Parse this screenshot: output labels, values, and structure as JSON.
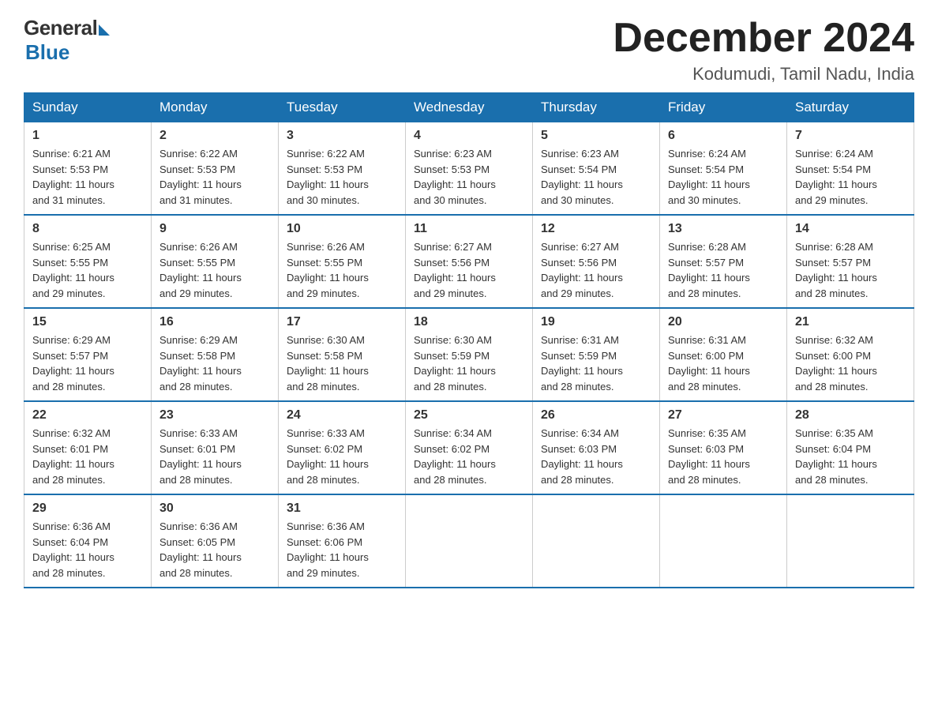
{
  "logo": {
    "general": "General",
    "blue": "Blue"
  },
  "title": "December 2024",
  "location": "Kodumudi, Tamil Nadu, India",
  "days_of_week": [
    "Sunday",
    "Monday",
    "Tuesday",
    "Wednesday",
    "Thursday",
    "Friday",
    "Saturday"
  ],
  "weeks": [
    [
      {
        "day": "1",
        "sunrise": "6:21 AM",
        "sunset": "5:53 PM",
        "daylight": "11 hours and 31 minutes."
      },
      {
        "day": "2",
        "sunrise": "6:22 AM",
        "sunset": "5:53 PM",
        "daylight": "11 hours and 31 minutes."
      },
      {
        "day": "3",
        "sunrise": "6:22 AM",
        "sunset": "5:53 PM",
        "daylight": "11 hours and 30 minutes."
      },
      {
        "day": "4",
        "sunrise": "6:23 AM",
        "sunset": "5:53 PM",
        "daylight": "11 hours and 30 minutes."
      },
      {
        "day": "5",
        "sunrise": "6:23 AM",
        "sunset": "5:54 PM",
        "daylight": "11 hours and 30 minutes."
      },
      {
        "day": "6",
        "sunrise": "6:24 AM",
        "sunset": "5:54 PM",
        "daylight": "11 hours and 30 minutes."
      },
      {
        "day": "7",
        "sunrise": "6:24 AM",
        "sunset": "5:54 PM",
        "daylight": "11 hours and 29 minutes."
      }
    ],
    [
      {
        "day": "8",
        "sunrise": "6:25 AM",
        "sunset": "5:55 PM",
        "daylight": "11 hours and 29 minutes."
      },
      {
        "day": "9",
        "sunrise": "6:26 AM",
        "sunset": "5:55 PM",
        "daylight": "11 hours and 29 minutes."
      },
      {
        "day": "10",
        "sunrise": "6:26 AM",
        "sunset": "5:55 PM",
        "daylight": "11 hours and 29 minutes."
      },
      {
        "day": "11",
        "sunrise": "6:27 AM",
        "sunset": "5:56 PM",
        "daylight": "11 hours and 29 minutes."
      },
      {
        "day": "12",
        "sunrise": "6:27 AM",
        "sunset": "5:56 PM",
        "daylight": "11 hours and 29 minutes."
      },
      {
        "day": "13",
        "sunrise": "6:28 AM",
        "sunset": "5:57 PM",
        "daylight": "11 hours and 28 minutes."
      },
      {
        "day": "14",
        "sunrise": "6:28 AM",
        "sunset": "5:57 PM",
        "daylight": "11 hours and 28 minutes."
      }
    ],
    [
      {
        "day": "15",
        "sunrise": "6:29 AM",
        "sunset": "5:57 PM",
        "daylight": "11 hours and 28 minutes."
      },
      {
        "day": "16",
        "sunrise": "6:29 AM",
        "sunset": "5:58 PM",
        "daylight": "11 hours and 28 minutes."
      },
      {
        "day": "17",
        "sunrise": "6:30 AM",
        "sunset": "5:58 PM",
        "daylight": "11 hours and 28 minutes."
      },
      {
        "day": "18",
        "sunrise": "6:30 AM",
        "sunset": "5:59 PM",
        "daylight": "11 hours and 28 minutes."
      },
      {
        "day": "19",
        "sunrise": "6:31 AM",
        "sunset": "5:59 PM",
        "daylight": "11 hours and 28 minutes."
      },
      {
        "day": "20",
        "sunrise": "6:31 AM",
        "sunset": "6:00 PM",
        "daylight": "11 hours and 28 minutes."
      },
      {
        "day": "21",
        "sunrise": "6:32 AM",
        "sunset": "6:00 PM",
        "daylight": "11 hours and 28 minutes."
      }
    ],
    [
      {
        "day": "22",
        "sunrise": "6:32 AM",
        "sunset": "6:01 PM",
        "daylight": "11 hours and 28 minutes."
      },
      {
        "day": "23",
        "sunrise": "6:33 AM",
        "sunset": "6:01 PM",
        "daylight": "11 hours and 28 minutes."
      },
      {
        "day": "24",
        "sunrise": "6:33 AM",
        "sunset": "6:02 PM",
        "daylight": "11 hours and 28 minutes."
      },
      {
        "day": "25",
        "sunrise": "6:34 AM",
        "sunset": "6:02 PM",
        "daylight": "11 hours and 28 minutes."
      },
      {
        "day": "26",
        "sunrise": "6:34 AM",
        "sunset": "6:03 PM",
        "daylight": "11 hours and 28 minutes."
      },
      {
        "day": "27",
        "sunrise": "6:35 AM",
        "sunset": "6:03 PM",
        "daylight": "11 hours and 28 minutes."
      },
      {
        "day": "28",
        "sunrise": "6:35 AM",
        "sunset": "6:04 PM",
        "daylight": "11 hours and 28 minutes."
      }
    ],
    [
      {
        "day": "29",
        "sunrise": "6:36 AM",
        "sunset": "6:04 PM",
        "daylight": "11 hours and 28 minutes."
      },
      {
        "day": "30",
        "sunrise": "6:36 AM",
        "sunset": "6:05 PM",
        "daylight": "11 hours and 28 minutes."
      },
      {
        "day": "31",
        "sunrise": "6:36 AM",
        "sunset": "6:06 PM",
        "daylight": "11 hours and 29 minutes."
      },
      null,
      null,
      null,
      null
    ]
  ],
  "labels": {
    "sunrise": "Sunrise:",
    "sunset": "Sunset:",
    "daylight": "Daylight:"
  }
}
